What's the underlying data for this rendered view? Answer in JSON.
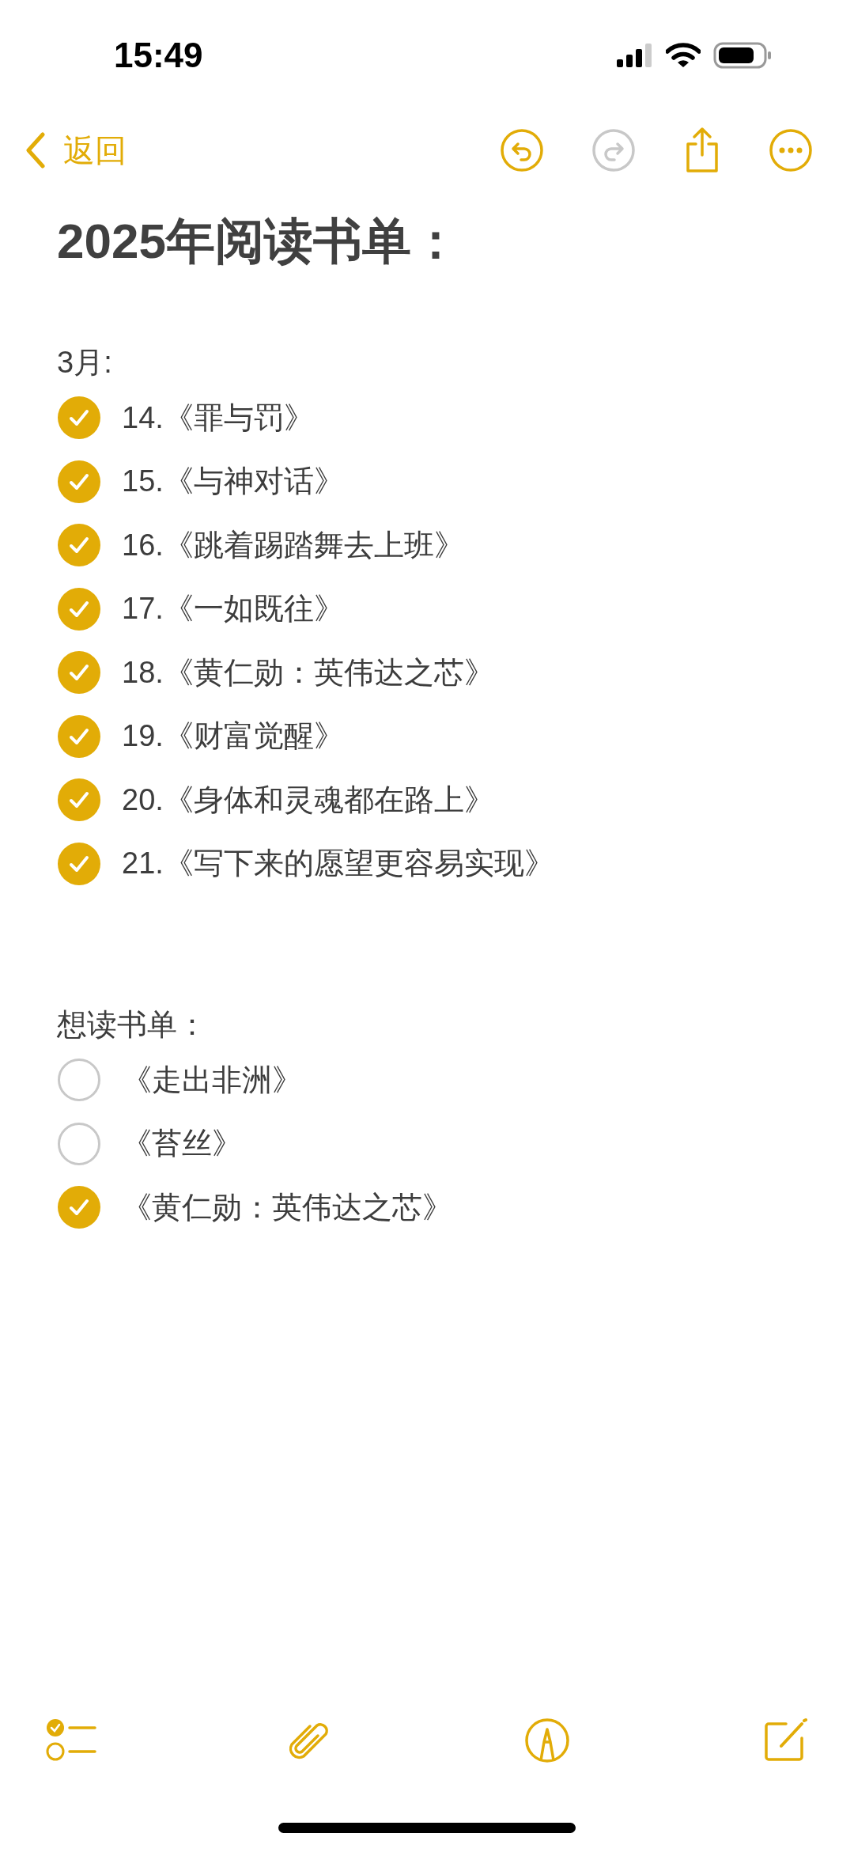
{
  "status_bar": {
    "time": "15:49"
  },
  "nav": {
    "back_label": "返回",
    "undo": {
      "disabled": false
    },
    "redo": {
      "disabled": true
    }
  },
  "note": {
    "title": "2025年阅读书单：",
    "sections": [
      {
        "heading": "3月:",
        "items": [
          {
            "text": "14.《罪与罚》",
            "checked": true
          },
          {
            "text": "15.《与神对话》",
            "checked": true
          },
          {
            "text": "16.《跳着踢踏舞去上班》",
            "checked": true
          },
          {
            "text": "17.《一如既往》",
            "checked": true
          },
          {
            "text": "18.《黄仁勋：英伟达之芯》",
            "checked": true
          },
          {
            "text": "19.《财富觉醒》",
            "checked": true
          },
          {
            "text": "20.《身体和灵魂都在路上》",
            "checked": true
          },
          {
            "text": "21.《写下来的愿望更容易实现》",
            "checked": true
          }
        ]
      },
      {
        "heading": "想读书单：",
        "items": [
          {
            "text": "《走出非洲》",
            "checked": false
          },
          {
            "text": "《苔丝》",
            "checked": false
          },
          {
            "text": "《黄仁勋：英伟达之芯》",
            "checked": true
          }
        ]
      }
    ]
  }
}
